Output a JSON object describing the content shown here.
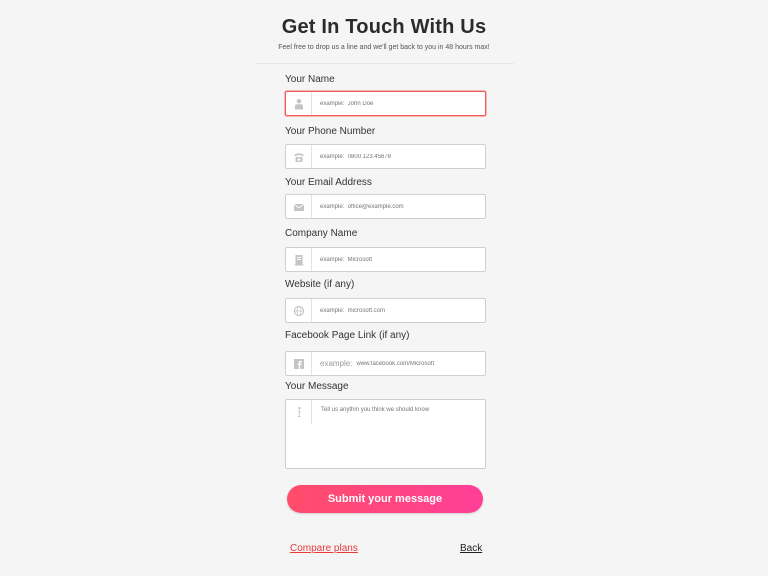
{
  "header": {
    "title": "Get In Touch With Us",
    "subtitle": "Feel free to drop us a line and we'll get back to you in 48 hours max!"
  },
  "form": {
    "name": {
      "label": "Your Name",
      "placeholder": "example:  John Doe",
      "icon": "person-icon"
    },
    "phone": {
      "label": "Your Phone Number",
      "placeholder": "example:  0800.123.45678",
      "icon": "telephone-icon"
    },
    "email": {
      "label": "Your Email Address",
      "placeholder": "example:  office@example.com",
      "icon": "envelope-icon"
    },
    "company": {
      "label": "Company Name",
      "placeholder": "example:  Microsoft",
      "icon": "building-icon"
    },
    "website": {
      "label": "Website (if any)",
      "placeholder": "example:  microsoft.com",
      "icon": "globe-icon"
    },
    "facebook": {
      "label": "Facebook Page Link (if any)",
      "prefix": "example:",
      "placeholder": "www.facebook.com/Microsoft",
      "icon": "facebook-icon"
    },
    "message": {
      "label": "Your Message",
      "placeholder": "Tell us anythin you think we should know",
      "icon": "info-icon"
    },
    "submit_label": "Submit your message"
  },
  "footer": {
    "compare_label": "Compare plans",
    "back_label": "Back"
  },
  "colors": {
    "accent_start": "#ff4d6a",
    "accent_end": "#ff3f97",
    "active_border": "#f25a5a",
    "link_red": "#e83a3a"
  }
}
